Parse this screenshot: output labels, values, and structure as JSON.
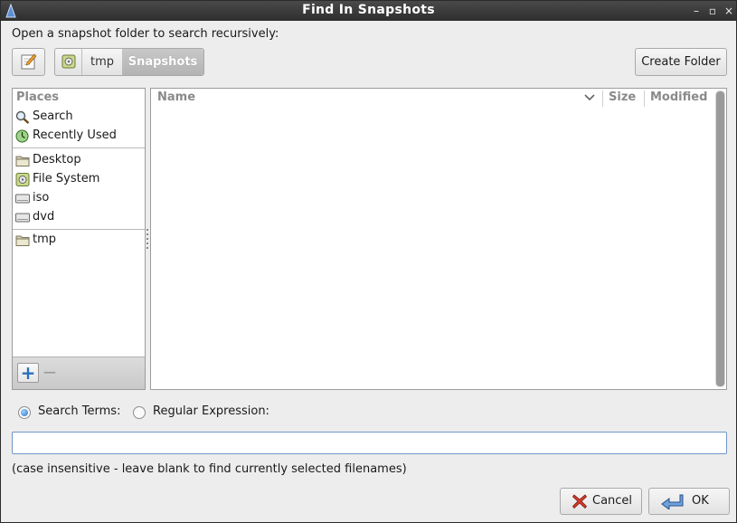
{
  "window": {
    "title": "Find In Snapshots",
    "controls": {
      "minimize": "–",
      "maximize": "▫",
      "close": "×"
    }
  },
  "prompt": "Open a snapshot folder to search recursively:",
  "pathbar": {
    "crumbs": [
      "tmp",
      "Snapshots"
    ],
    "active": "Snapshots"
  },
  "create_folder_label": "Create Folder",
  "places": {
    "header": "Places",
    "items": [
      {
        "label": "Search",
        "icon": "search-icon"
      },
      {
        "label": "Recently Used",
        "icon": "recent-icon"
      },
      {
        "label": "Desktop",
        "icon": "folder-icon"
      },
      {
        "label": "File System",
        "icon": "drive-icon"
      },
      {
        "label": "iso",
        "icon": "drive-icon"
      },
      {
        "label": "dvd",
        "icon": "drive-icon"
      },
      {
        "label": "tmp",
        "icon": "folder-icon"
      }
    ],
    "add_label": "+",
    "remove_label": "−"
  },
  "filelist": {
    "columns": [
      "Name",
      "Size",
      "Modified"
    ],
    "rows": []
  },
  "search": {
    "option_terms": "Search Terms:",
    "option_regex": "Regular Expression:",
    "selected": "terms",
    "value": "",
    "hint": "(case insensitive - leave blank to find currently selected filenames)"
  },
  "buttons": {
    "cancel": "Cancel",
    "ok": "OK"
  },
  "colors": {
    "accent": "#2a73c6",
    "titlebar": "#3a3a3a",
    "window_bg": "#ededed"
  }
}
